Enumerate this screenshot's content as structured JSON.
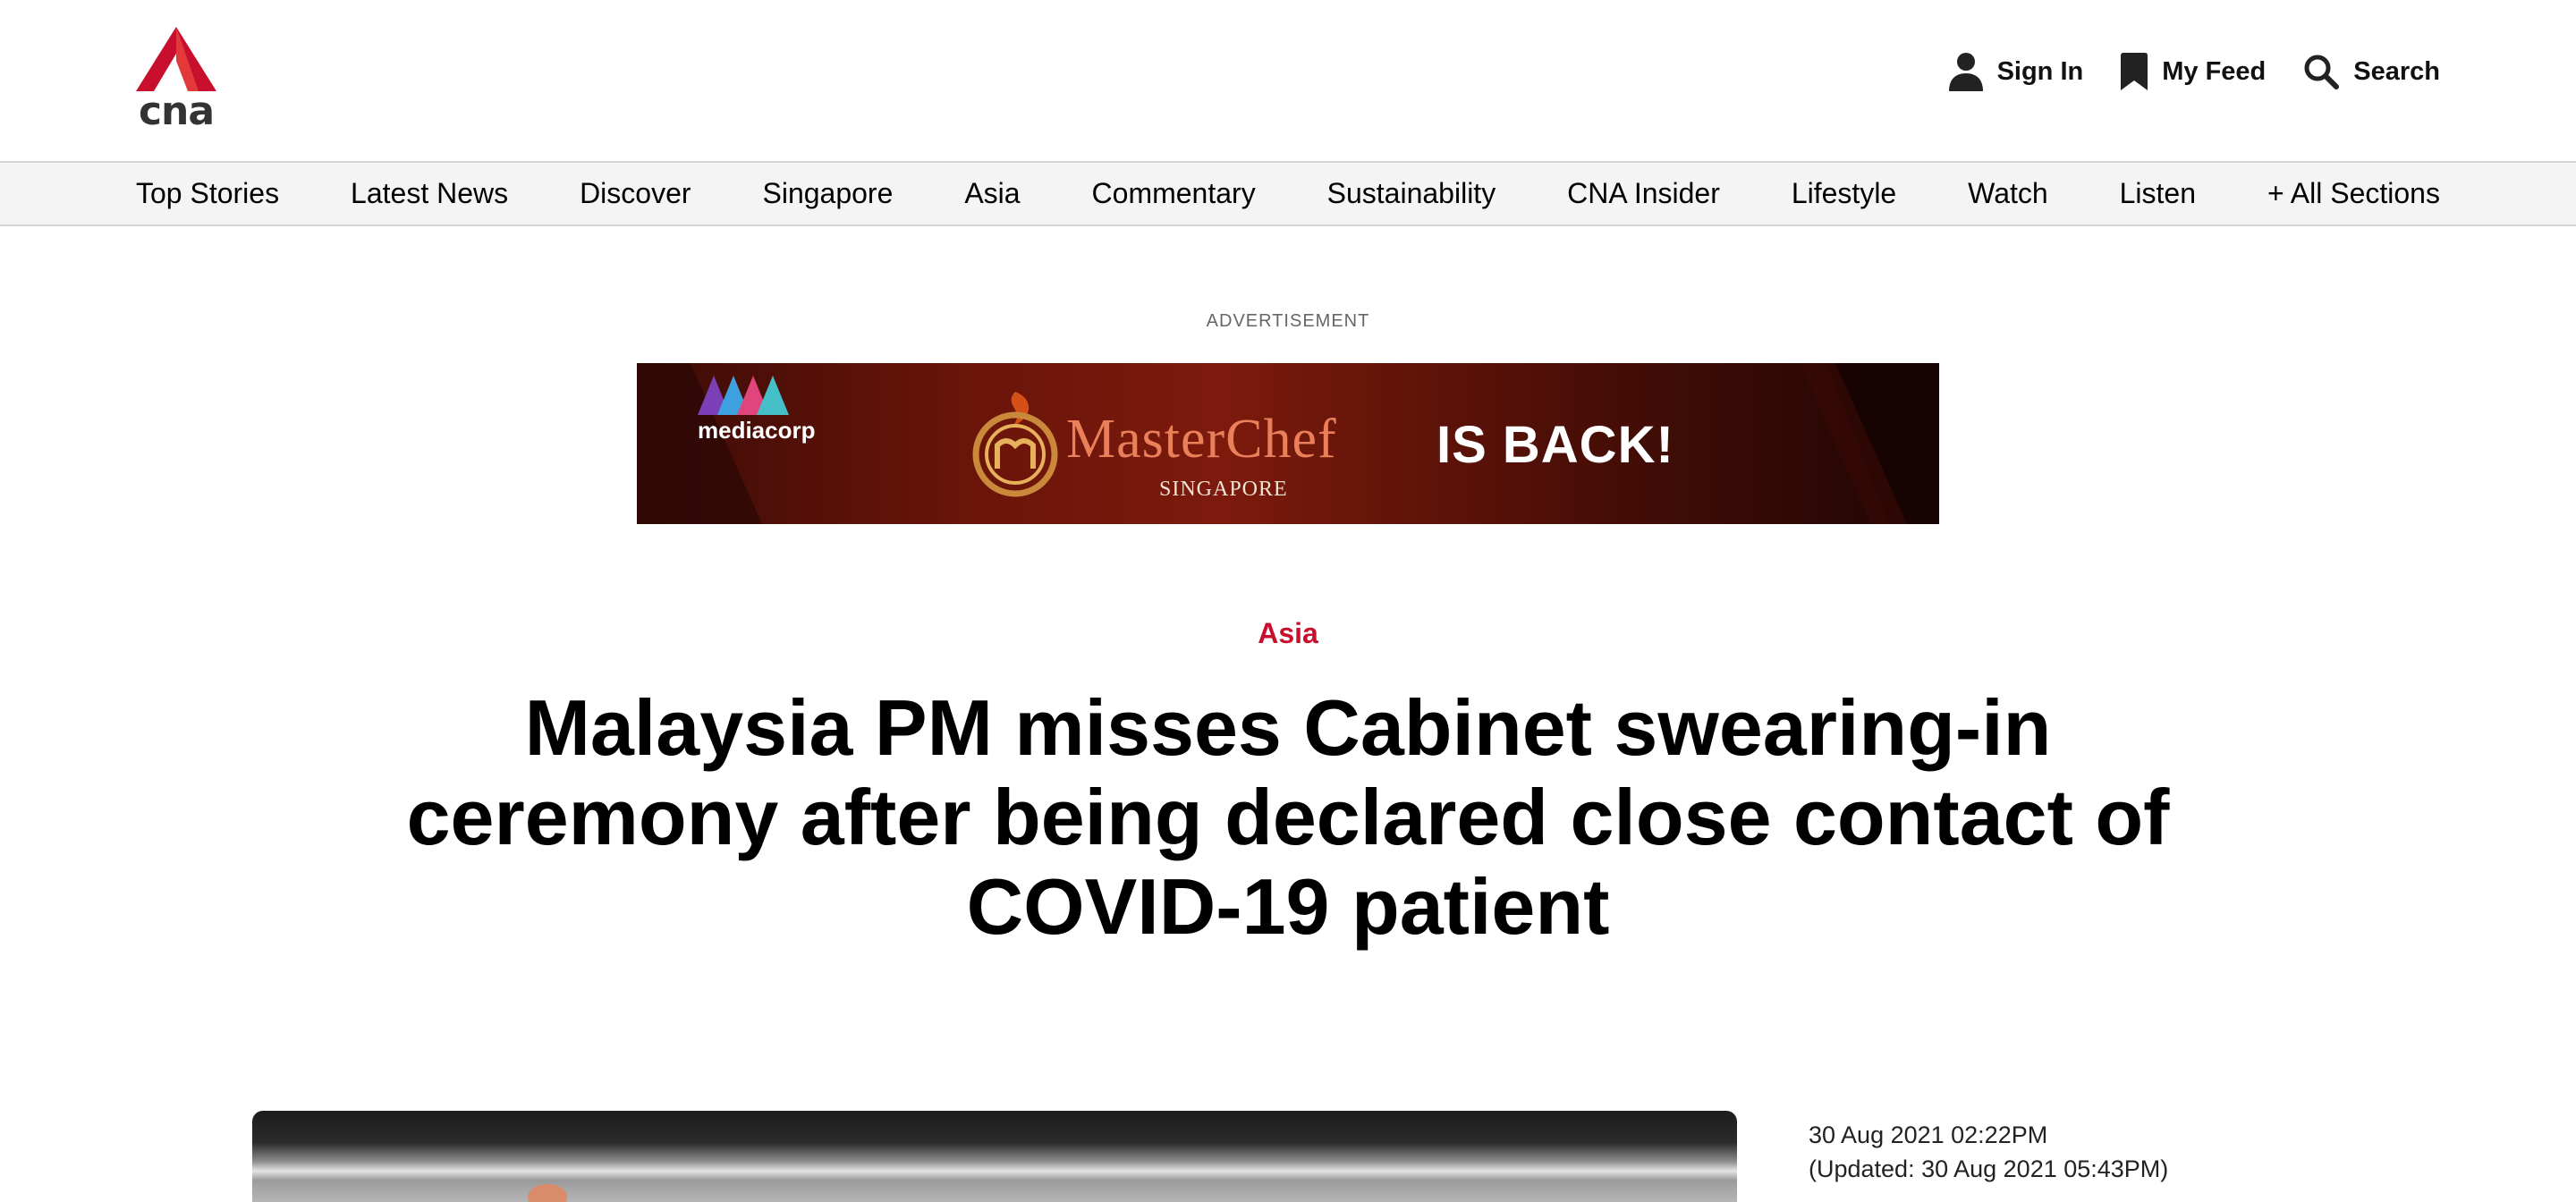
{
  "brand": {
    "logo_text": "cna",
    "accent_color": "#c8102e"
  },
  "header": {
    "actions": [
      {
        "label": "Sign In",
        "icon": "user-icon"
      },
      {
        "label": "My Feed",
        "icon": "bookmark-icon"
      },
      {
        "label": "Search",
        "icon": "search-icon"
      }
    ]
  },
  "nav": {
    "items": [
      "Top Stories",
      "Latest News",
      "Discover",
      "Singapore",
      "Asia",
      "Commentary",
      "Sustainability",
      "CNA Insider",
      "Lifestyle",
      "Watch",
      "Listen",
      "+ All Sections"
    ]
  },
  "ad": {
    "label": "ADVERTISEMENT",
    "sponsor": "mediacorp",
    "title": "MasterChef",
    "subtitle": "SINGAPORE",
    "tagline": "IS BACK!"
  },
  "article": {
    "category": "Asia",
    "headline": "Malaysia PM misses Cabinet swearing-in ceremony after being declared close contact of COVID-19 patient",
    "published": "30 Aug 2021 02:22PM",
    "updated": "(Updated: 30 Aug 2021 05:43PM)"
  }
}
